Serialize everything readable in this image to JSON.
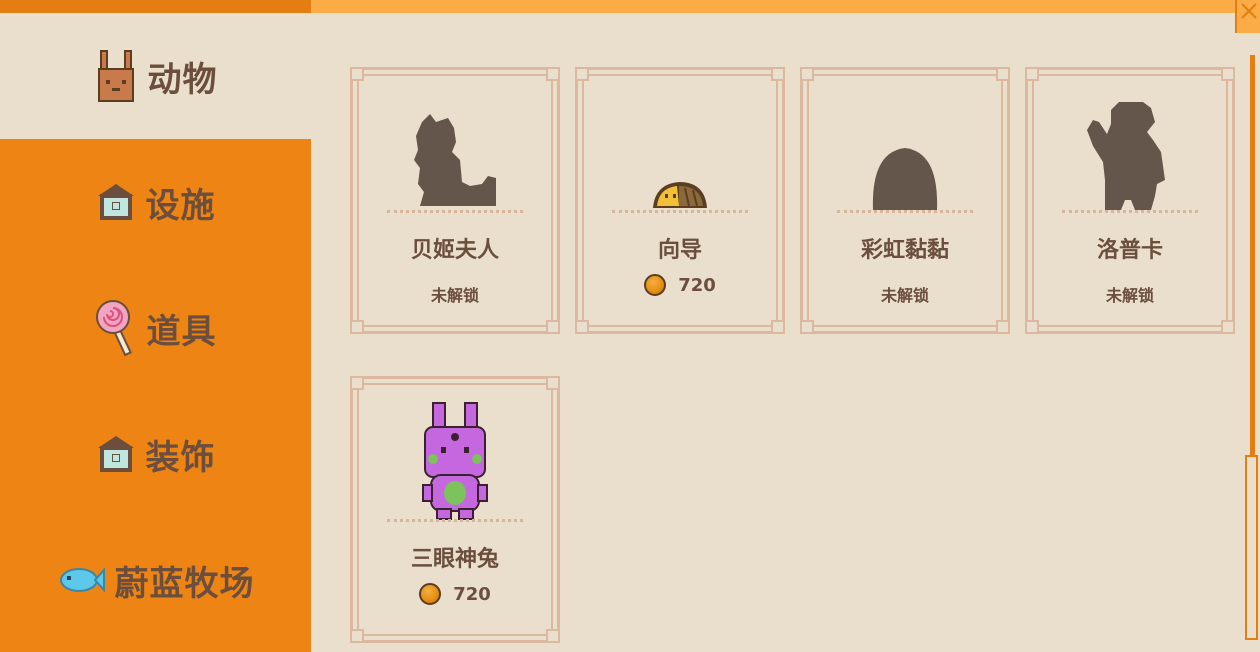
{
  "colors": {
    "sidebar": "#ee8413",
    "background": "#e9dfcc",
    "accent_bar": "#fbac47",
    "text": "#6b4e3d",
    "card_border": "#dcb8a0"
  },
  "sidebar": {
    "tabs": [
      {
        "label": "动物",
        "icon": "rabbit-icon",
        "active": true
      },
      {
        "label": "设施",
        "icon": "facility-house-icon",
        "active": false
      },
      {
        "label": "道具",
        "icon": "lollipop-icon",
        "active": false
      },
      {
        "label": "装饰",
        "icon": "decoration-house-icon",
        "active": false
      },
      {
        "label": "蔚蓝牧场",
        "icon": "fish-icon",
        "active": false
      }
    ]
  },
  "cards": [
    {
      "name": "贝姬夫人",
      "status": "未解锁",
      "price": null,
      "icon": "cat-silhouette-icon"
    },
    {
      "name": "向导",
      "status": null,
      "price": "720",
      "icon": "guide-creature-icon"
    },
    {
      "name": "彩虹黏黏",
      "status": "未解锁",
      "price": null,
      "icon": "slime-silhouette-icon"
    },
    {
      "name": "洛普卡",
      "status": "未解锁",
      "price": null,
      "icon": "bear-silhouette-icon"
    },
    {
      "name": "三眼神兔",
      "status": null,
      "price": "720",
      "icon": "three-eyed-rabbit-icon"
    }
  ]
}
